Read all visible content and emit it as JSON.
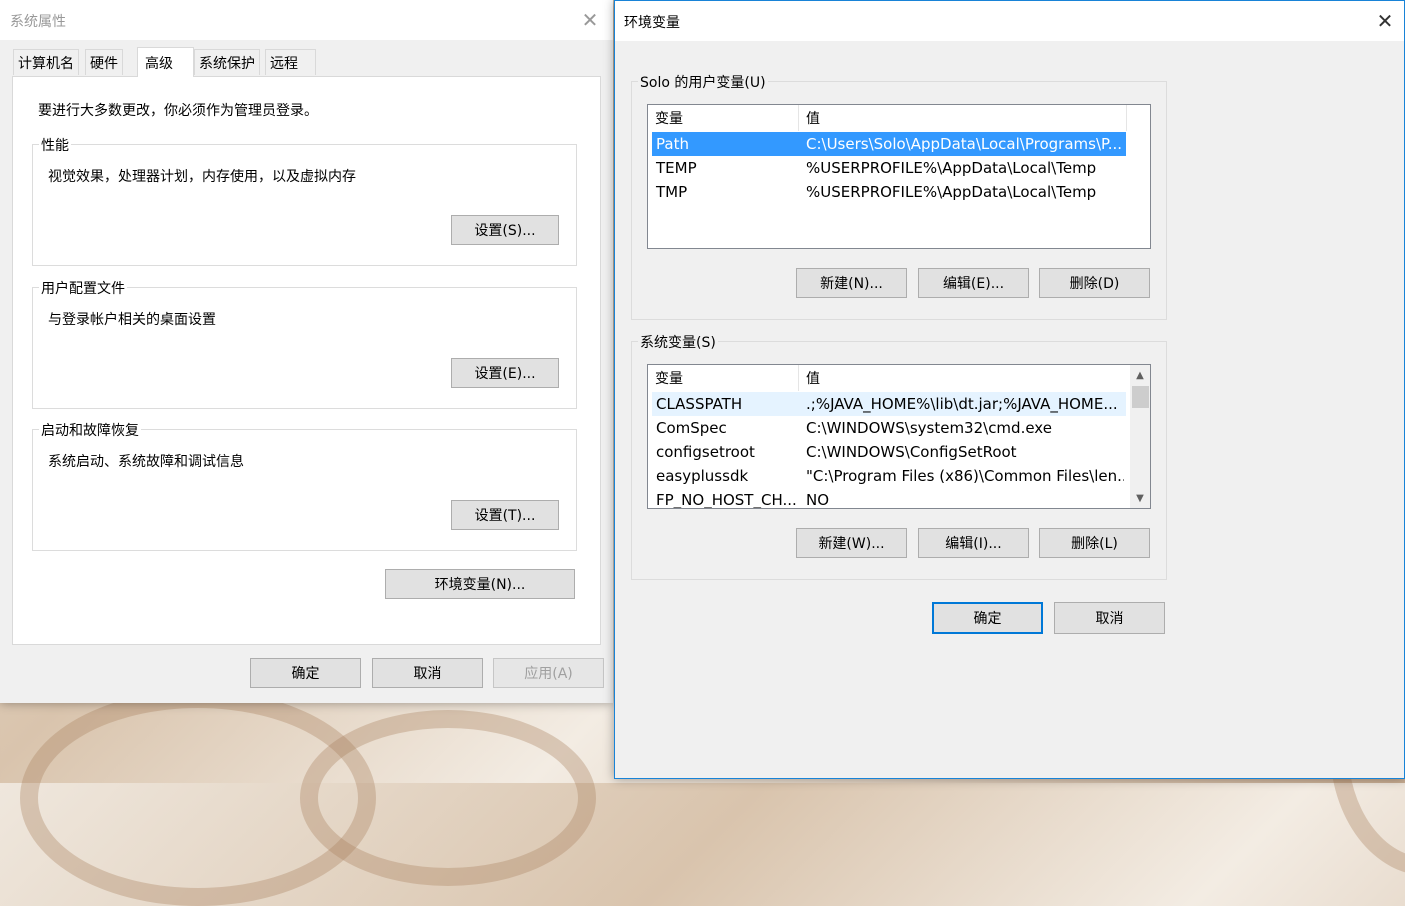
{
  "sys_props": {
    "title": "系统属性",
    "tabs": [
      "计算机名",
      "硬件",
      "高级",
      "系统保护",
      "远程"
    ],
    "admin_note": "要进行大多数更改，你必须作为管理员登录。",
    "performance": {
      "label": "性能",
      "desc": "视觉效果，处理器计划，内存使用，以及虚拟内存",
      "button": "设置(S)..."
    },
    "user_profiles": {
      "label": "用户配置文件",
      "desc": "与登录帐户相关的桌面设置",
      "button": "设置(E)..."
    },
    "startup_recovery": {
      "label": "启动和故障恢复",
      "desc": "系统启动、系统故障和调试信息",
      "button": "设置(T)..."
    },
    "env_button": "环境变量(N)...",
    "ok": "确定",
    "cancel": "取消",
    "apply": "应用(A)"
  },
  "env_vars": {
    "title": "环境变量",
    "user_group_label": "Solo 的用户变量(U)",
    "col_var": "变量",
    "col_val": "值",
    "user_rows": [
      {
        "name": "Path",
        "value": "C:\\Users\\Solo\\AppData\\Local\\Programs\\P..."
      },
      {
        "name": "TEMP",
        "value": "%USERPROFILE%\\AppData\\Local\\Temp"
      },
      {
        "name": "TMP",
        "value": "%USERPROFILE%\\AppData\\Local\\Temp"
      }
    ],
    "user_new": "新建(N)...",
    "user_edit": "编辑(E)...",
    "user_delete": "删除(D)",
    "sys_group_label": "系统变量(S)",
    "sys_rows": [
      {
        "name": "CLASSPATH",
        "value": ".;%JAVA_HOME%\\lib\\dt.jar;%JAVA_HOME..."
      },
      {
        "name": "ComSpec",
        "value": "C:\\WINDOWS\\system32\\cmd.exe"
      },
      {
        "name": "configsetroot",
        "value": "C:\\WINDOWS\\ConfigSetRoot"
      },
      {
        "name": "easyplussdk",
        "value": "\"C:\\Program Files (x86)\\Common Files\\len..."
      },
      {
        "name": "FP_NO_HOST_CH...",
        "value": "NO"
      }
    ],
    "sys_new": "新建(W)...",
    "sys_edit": "编辑(I)...",
    "sys_delete": "删除(L)",
    "ok": "确定",
    "cancel": "取消"
  },
  "colors": {
    "selection": "#3399ff",
    "hover": "#e5f3ff",
    "focus_border": "#0078d7",
    "dialog_bg": "#f0f0f0"
  },
  "icons": [
    "close-icon",
    "scroll-up-icon",
    "scroll-down-icon"
  ]
}
